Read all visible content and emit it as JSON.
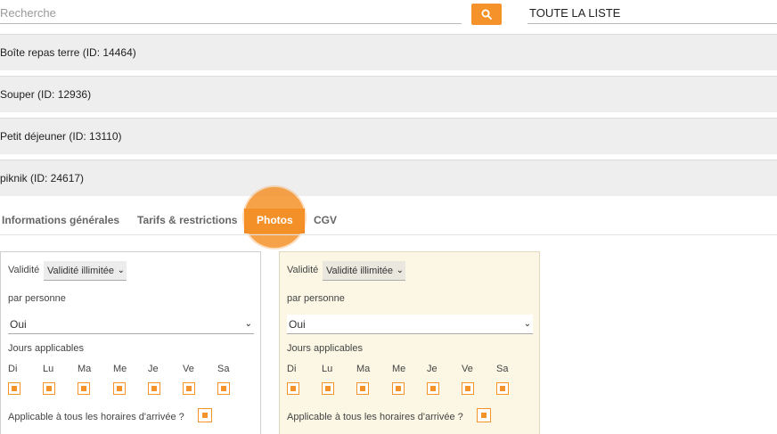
{
  "search": {
    "placeholder": "Recherche",
    "button_icon": "search-icon"
  },
  "list_filter": {
    "value": "TOUTE LA LISTE"
  },
  "items": [
    {
      "label": "Boîte repas terre (ID: 14464)"
    },
    {
      "label": "Souper (ID: 12936)"
    },
    {
      "label": "Petit déjeuner (ID: 13110)"
    },
    {
      "label": "piknik (ID: 24617)"
    }
  ],
  "tabs": [
    {
      "label": "Informations générales"
    },
    {
      "label": "Tarifs & restrictions"
    },
    {
      "label": "Photos",
      "active": true
    },
    {
      "label": "CGV"
    }
  ],
  "panels": [
    {
      "validity_label": "Validité",
      "validity_value": "Validité illimitée",
      "per_person_label": "par personne",
      "per_person_value": "Oui",
      "days_label": "Jours applicables",
      "days": [
        "Di",
        "Lu",
        "Ma",
        "Me",
        "Je",
        "Ve",
        "Sa"
      ],
      "arrival_label": "Applicable à tous les horaires d'arrivée ?"
    },
    {
      "validity_label": "Validité",
      "validity_value": "Validité illimitée",
      "per_person_label": "par personne",
      "per_person_value": "Oui",
      "days_label": "Jours applicables",
      "days": [
        "Di",
        "Lu",
        "Ma",
        "Me",
        "Je",
        "Ve",
        "Sa"
      ],
      "arrival_label": "Applicable à tous les horaires d'arrivée ?"
    }
  ],
  "colors": {
    "accent": "#f5922a",
    "row_bg": "#eeeeee",
    "panel_alt_bg": "#fbf7e4"
  }
}
